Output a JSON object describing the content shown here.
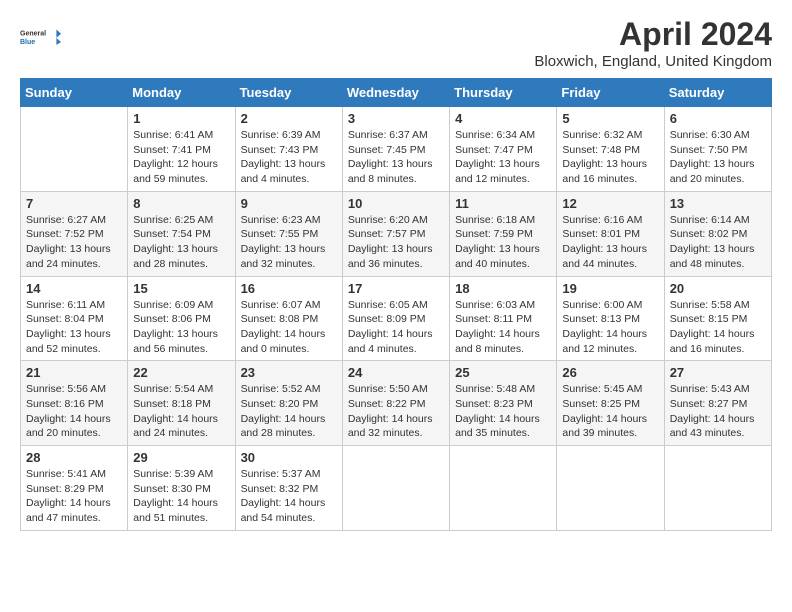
{
  "header": {
    "logo_line1": "General",
    "logo_line2": "Blue",
    "month": "April 2024",
    "location": "Bloxwich, England, United Kingdom"
  },
  "weekdays": [
    "Sunday",
    "Monday",
    "Tuesday",
    "Wednesday",
    "Thursday",
    "Friday",
    "Saturday"
  ],
  "weeks": [
    [
      {
        "day": "",
        "sunrise": "",
        "sunset": "",
        "daylight": ""
      },
      {
        "day": "1",
        "sunrise": "Sunrise: 6:41 AM",
        "sunset": "Sunset: 7:41 PM",
        "daylight": "Daylight: 12 hours and 59 minutes."
      },
      {
        "day": "2",
        "sunrise": "Sunrise: 6:39 AM",
        "sunset": "Sunset: 7:43 PM",
        "daylight": "Daylight: 13 hours and 4 minutes."
      },
      {
        "day": "3",
        "sunrise": "Sunrise: 6:37 AM",
        "sunset": "Sunset: 7:45 PM",
        "daylight": "Daylight: 13 hours and 8 minutes."
      },
      {
        "day": "4",
        "sunrise": "Sunrise: 6:34 AM",
        "sunset": "Sunset: 7:47 PM",
        "daylight": "Daylight: 13 hours and 12 minutes."
      },
      {
        "day": "5",
        "sunrise": "Sunrise: 6:32 AM",
        "sunset": "Sunset: 7:48 PM",
        "daylight": "Daylight: 13 hours and 16 minutes."
      },
      {
        "day": "6",
        "sunrise": "Sunrise: 6:30 AM",
        "sunset": "Sunset: 7:50 PM",
        "daylight": "Daylight: 13 hours and 20 minutes."
      }
    ],
    [
      {
        "day": "7",
        "sunrise": "Sunrise: 6:27 AM",
        "sunset": "Sunset: 7:52 PM",
        "daylight": "Daylight: 13 hours and 24 minutes."
      },
      {
        "day": "8",
        "sunrise": "Sunrise: 6:25 AM",
        "sunset": "Sunset: 7:54 PM",
        "daylight": "Daylight: 13 hours and 28 minutes."
      },
      {
        "day": "9",
        "sunrise": "Sunrise: 6:23 AM",
        "sunset": "Sunset: 7:55 PM",
        "daylight": "Daylight: 13 hours and 32 minutes."
      },
      {
        "day": "10",
        "sunrise": "Sunrise: 6:20 AM",
        "sunset": "Sunset: 7:57 PM",
        "daylight": "Daylight: 13 hours and 36 minutes."
      },
      {
        "day": "11",
        "sunrise": "Sunrise: 6:18 AM",
        "sunset": "Sunset: 7:59 PM",
        "daylight": "Daylight: 13 hours and 40 minutes."
      },
      {
        "day": "12",
        "sunrise": "Sunrise: 6:16 AM",
        "sunset": "Sunset: 8:01 PM",
        "daylight": "Daylight: 13 hours and 44 minutes."
      },
      {
        "day": "13",
        "sunrise": "Sunrise: 6:14 AM",
        "sunset": "Sunset: 8:02 PM",
        "daylight": "Daylight: 13 hours and 48 minutes."
      }
    ],
    [
      {
        "day": "14",
        "sunrise": "Sunrise: 6:11 AM",
        "sunset": "Sunset: 8:04 PM",
        "daylight": "Daylight: 13 hours and 52 minutes."
      },
      {
        "day": "15",
        "sunrise": "Sunrise: 6:09 AM",
        "sunset": "Sunset: 8:06 PM",
        "daylight": "Daylight: 13 hours and 56 minutes."
      },
      {
        "day": "16",
        "sunrise": "Sunrise: 6:07 AM",
        "sunset": "Sunset: 8:08 PM",
        "daylight": "Daylight: 14 hours and 0 minutes."
      },
      {
        "day": "17",
        "sunrise": "Sunrise: 6:05 AM",
        "sunset": "Sunset: 8:09 PM",
        "daylight": "Daylight: 14 hours and 4 minutes."
      },
      {
        "day": "18",
        "sunrise": "Sunrise: 6:03 AM",
        "sunset": "Sunset: 8:11 PM",
        "daylight": "Daylight: 14 hours and 8 minutes."
      },
      {
        "day": "19",
        "sunrise": "Sunrise: 6:00 AM",
        "sunset": "Sunset: 8:13 PM",
        "daylight": "Daylight: 14 hours and 12 minutes."
      },
      {
        "day": "20",
        "sunrise": "Sunrise: 5:58 AM",
        "sunset": "Sunset: 8:15 PM",
        "daylight": "Daylight: 14 hours and 16 minutes."
      }
    ],
    [
      {
        "day": "21",
        "sunrise": "Sunrise: 5:56 AM",
        "sunset": "Sunset: 8:16 PM",
        "daylight": "Daylight: 14 hours and 20 minutes."
      },
      {
        "day": "22",
        "sunrise": "Sunrise: 5:54 AM",
        "sunset": "Sunset: 8:18 PM",
        "daylight": "Daylight: 14 hours and 24 minutes."
      },
      {
        "day": "23",
        "sunrise": "Sunrise: 5:52 AM",
        "sunset": "Sunset: 8:20 PM",
        "daylight": "Daylight: 14 hours and 28 minutes."
      },
      {
        "day": "24",
        "sunrise": "Sunrise: 5:50 AM",
        "sunset": "Sunset: 8:22 PM",
        "daylight": "Daylight: 14 hours and 32 minutes."
      },
      {
        "day": "25",
        "sunrise": "Sunrise: 5:48 AM",
        "sunset": "Sunset: 8:23 PM",
        "daylight": "Daylight: 14 hours and 35 minutes."
      },
      {
        "day": "26",
        "sunrise": "Sunrise: 5:45 AM",
        "sunset": "Sunset: 8:25 PM",
        "daylight": "Daylight: 14 hours and 39 minutes."
      },
      {
        "day": "27",
        "sunrise": "Sunrise: 5:43 AM",
        "sunset": "Sunset: 8:27 PM",
        "daylight": "Daylight: 14 hours and 43 minutes."
      }
    ],
    [
      {
        "day": "28",
        "sunrise": "Sunrise: 5:41 AM",
        "sunset": "Sunset: 8:29 PM",
        "daylight": "Daylight: 14 hours and 47 minutes."
      },
      {
        "day": "29",
        "sunrise": "Sunrise: 5:39 AM",
        "sunset": "Sunset: 8:30 PM",
        "daylight": "Daylight: 14 hours and 51 minutes."
      },
      {
        "day": "30",
        "sunrise": "Sunrise: 5:37 AM",
        "sunset": "Sunset: 8:32 PM",
        "daylight": "Daylight: 14 hours and 54 minutes."
      },
      {
        "day": "",
        "sunrise": "",
        "sunset": "",
        "daylight": ""
      },
      {
        "day": "",
        "sunrise": "",
        "sunset": "",
        "daylight": ""
      },
      {
        "day": "",
        "sunrise": "",
        "sunset": "",
        "daylight": ""
      },
      {
        "day": "",
        "sunrise": "",
        "sunset": "",
        "daylight": ""
      }
    ]
  ]
}
